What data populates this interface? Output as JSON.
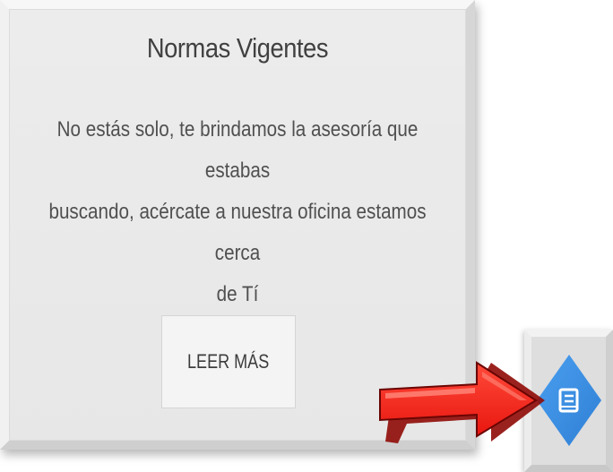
{
  "card": {
    "title": "Normas Vigentes",
    "text_lines": [
      "No estás solo, te brindamos la asesoría que estabas",
      "buscando, acércate a nuestra oficina estamos cerca",
      "de Tí"
    ],
    "button_label": "LEER MÁS"
  },
  "icon_panel": {
    "icon": "book-icon",
    "shape": "diamond",
    "color": "#3d8fe0"
  },
  "arrow": {
    "icon": "right-arrow-icon",
    "color": "#e8160f"
  }
}
